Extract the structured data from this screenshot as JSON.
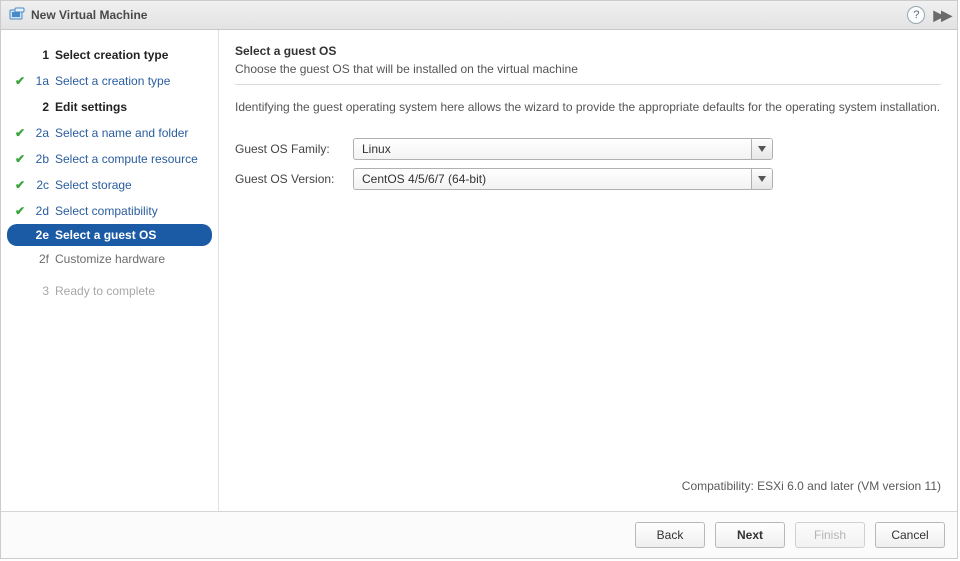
{
  "window": {
    "title": "New Virtual Machine"
  },
  "sidebar": {
    "items": [
      {
        "num": "1",
        "label": "Select creation type",
        "kind": "top"
      },
      {
        "num": "1a",
        "label": "Select a creation type",
        "kind": "completed"
      },
      {
        "num": "2",
        "label": "Edit settings",
        "kind": "top"
      },
      {
        "num": "2a",
        "label": "Select a name and folder",
        "kind": "completed"
      },
      {
        "num": "2b",
        "label": "Select a compute resource",
        "kind": "completed"
      },
      {
        "num": "2c",
        "label": "Select storage",
        "kind": "completed"
      },
      {
        "num": "2d",
        "label": "Select compatibility",
        "kind": "completed"
      },
      {
        "num": "2e",
        "label": "Select a guest OS",
        "kind": "active"
      },
      {
        "num": "2f",
        "label": "Customize hardware",
        "kind": "upcoming"
      },
      {
        "num": "3",
        "label": "Ready to complete",
        "kind": "disabled"
      }
    ]
  },
  "main": {
    "heading": "Select a guest OS",
    "subtitle": "Choose the guest OS that will be installed on the virtual machine",
    "description": "Identifying the guest operating system here allows the wizard to provide the appropriate defaults for the operating system installation.",
    "family_label": "Guest OS Family:",
    "family_value": "Linux",
    "version_label": "Guest OS Version:",
    "version_value": "CentOS 4/5/6/7 (64-bit)",
    "compat": "Compatibility: ESXi 6.0 and later (VM version 11)"
  },
  "buttons": {
    "back": "Back",
    "next": "Next",
    "finish": "Finish",
    "cancel": "Cancel"
  }
}
